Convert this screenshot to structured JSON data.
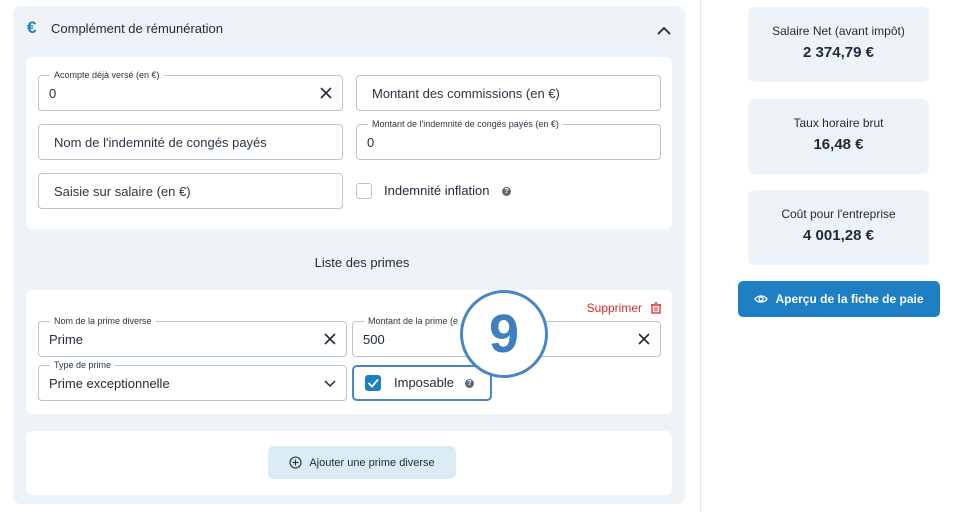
{
  "section": {
    "title": "Complément de rémunération",
    "icon": "euro-icon"
  },
  "fields": {
    "acompte": {
      "label": "Acompte déjà versé (en €)",
      "value": "0"
    },
    "commissions": {
      "placeholder": "Montant des commissions (en €)"
    },
    "conges_nom": {
      "placeholder": "Nom de l'indemnité de congés payés"
    },
    "conges_montant": {
      "label": "Montant de l'indemnité de congés payés (en €)",
      "value": "0"
    },
    "saisie": {
      "placeholder": "Saisie sur salaire (en €)"
    },
    "inflation": {
      "label": "Indemnité inflation",
      "checked": false
    }
  },
  "primes": {
    "title": "Liste des primes",
    "delete_label": "Supprimer",
    "nom": {
      "label": "Nom de la prime diverse",
      "value": "Prime"
    },
    "montant": {
      "label": "Montant de la prime (e",
      "value": "500"
    },
    "type": {
      "label": "Type de prime",
      "value": "Prime exceptionnelle"
    },
    "imposable": {
      "label": "Imposable",
      "checked": true
    },
    "add_label": "Ajouter une prime diverse"
  },
  "summary": {
    "net": {
      "label": "Salaire Net (avant impôt)",
      "value": "2 374,79 €"
    },
    "taux": {
      "label": "Taux horaire brut",
      "value": "16,48 €"
    },
    "cout": {
      "label": "Coût pour l'entreprise",
      "value": "4 001,28 €"
    },
    "preview_label": "Aperçu de la fiche de paie"
  },
  "step_badge": "9",
  "colors": {
    "accent": "#1f7fc4",
    "danger": "#d52a2a",
    "panel": "#eef3f7"
  }
}
